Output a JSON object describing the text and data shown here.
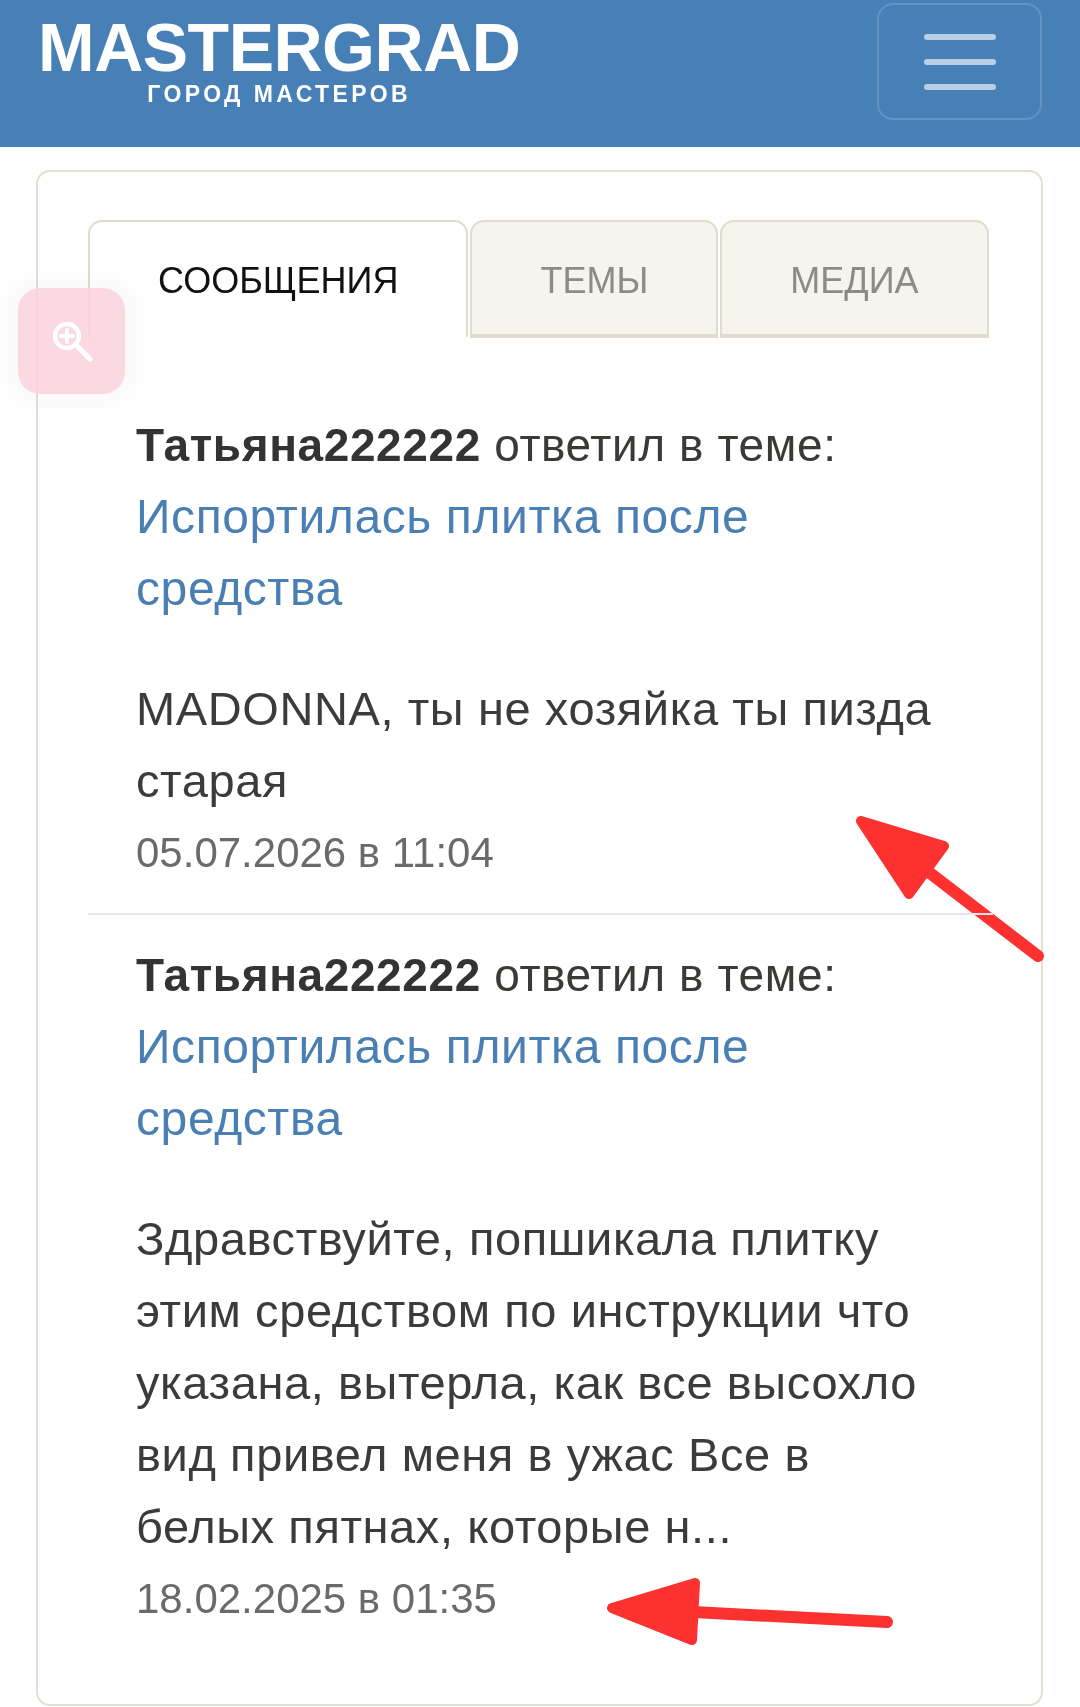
{
  "header": {
    "logo": "MASTERGRAD",
    "tagline": "ГОРОД МАСТЕРОВ"
  },
  "tabs": [
    {
      "label": "СООБЩЕНИЯ",
      "selected": true
    },
    {
      "label": "ТЕМЫ",
      "selected": false
    },
    {
      "label": "МЕДИА",
      "selected": false
    }
  ],
  "posts": [
    {
      "byline": "**Татьяна222222** ответил в теме:",
      "topic": "Испортилась плитка после средства",
      "excerpt": "MADONNA, ты не хозяйка ты пизда старая",
      "date": "05.07.2026 в 11:04",
      "arrow": {
        "kind": "diagonal"
      }
    },
    {
      "byline": "**Татьяна222222** ответил в теме:",
      "topic": "Испортилась плитка после средства",
      "excerpt": "Здравствуйте, попшикала плитку этим средством по инструкции что указана, вытерла, как все высохло вид привел меня в ужас Все в белых пятнах, которые н...",
      "date": "18.02.2025 в 01:35",
      "arrow": {
        "kind": "horizontal"
      }
    }
  ]
}
